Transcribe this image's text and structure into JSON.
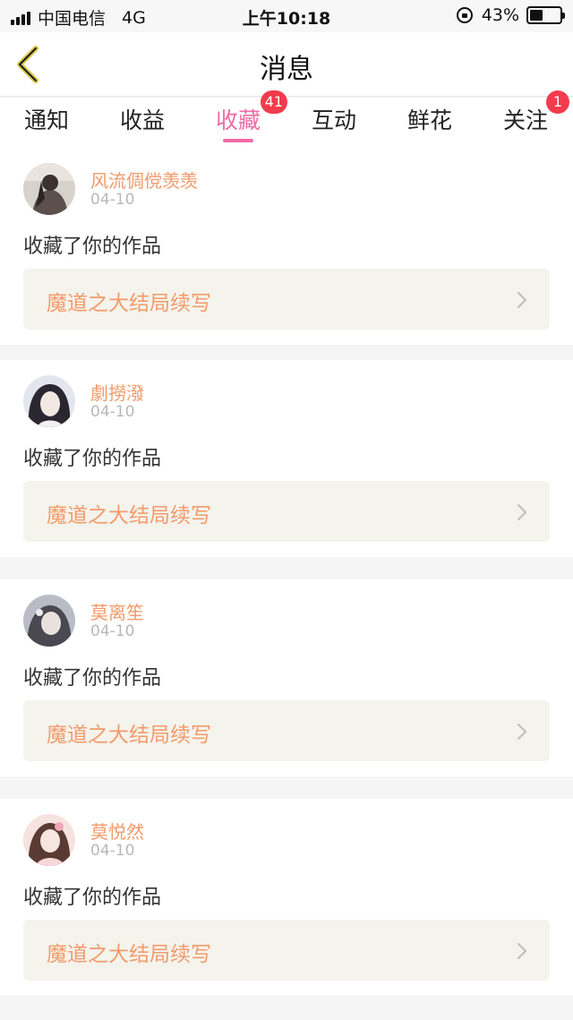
{
  "status_bar": {
    "carrier": "中国电信",
    "network": "4G",
    "time": "上午10:18",
    "battery_text": "43%",
    "battery_level": 0.43
  },
  "header": {
    "title": "消息",
    "back_icon": "chevron-left-icon"
  },
  "tabs": [
    {
      "label": "通知",
      "badge": ""
    },
    {
      "label": "收益",
      "badge": ""
    },
    {
      "label": "收藏",
      "badge": "41",
      "active": true
    },
    {
      "label": "互动",
      "badge": ""
    },
    {
      "label": "鲜花",
      "badge": ""
    },
    {
      "label": "关注",
      "badge": "1"
    }
  ],
  "colors": {
    "accent": "#f06aa6",
    "badge": "#f23b4c",
    "username": "#f09a6a",
    "work_title": "#f29b6b"
  },
  "messages": [
    {
      "user": "风流倜傥羡羡",
      "date": "04-10",
      "action": "收藏了你的作品",
      "work": "魔道之大结局续写"
    },
    {
      "user": "劇撈潑",
      "date": "04-10",
      "action": "收藏了你的作品",
      "work": "魔道之大结局续写"
    },
    {
      "user": "莫离笙",
      "date": "04-10",
      "action": "收藏了你的作品",
      "work": "魔道之大结局续写"
    },
    {
      "user": "莫悦然",
      "date": "04-10",
      "action": "收藏了你的作品",
      "work": "魔道之大结局续写"
    }
  ]
}
